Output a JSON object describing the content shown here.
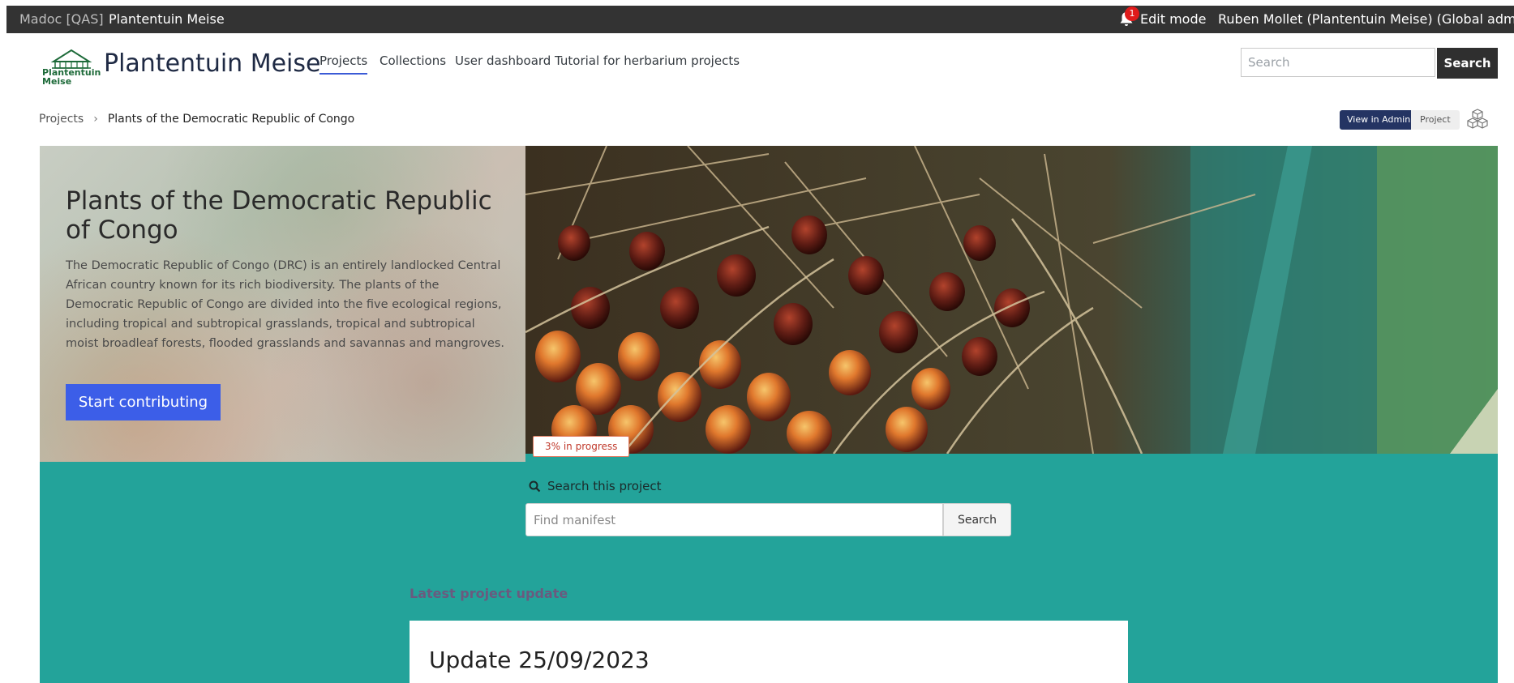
{
  "topbar": {
    "site_label": "Madoc [QAS]",
    "site_name": "Plantentuin Meise",
    "notification_count": "1",
    "edit_mode": "Edit mode",
    "user": "Ruben Mollet (Plantentuin Meise) (Global admin)"
  },
  "header": {
    "logo_line1": "Plantentuin",
    "logo_line2": "Meise",
    "title": "Plantentuin Meise",
    "nav": [
      "Projects",
      "Collections",
      "User dashboard",
      "Tutorial for herbarium projects"
    ],
    "search_placeholder": "Search",
    "search_button": "Search"
  },
  "breadcrumb": {
    "root": "Projects",
    "current": "Plants of the Democratic Republic of Congo"
  },
  "admin": {
    "view_in_admin": "View in Admin",
    "project": "Project"
  },
  "hero": {
    "title": "Plants of the Democratic Republic of Congo",
    "description": "The Democratic Republic of Congo (DRC) is an entirely landlocked Central African country known for its rich biodiversity. The plants of the Democratic Republic of Congo are divided into the five ecological regions, including tropical and subtropical grasslands, tropical and subtropical moist broadleaf forests, flooded grasslands and savannas and mangroves.",
    "cta": "Start contributing",
    "progress": "3% in progress"
  },
  "project_search": {
    "label": "Search this project",
    "placeholder": "Find manifest",
    "button": "Search"
  },
  "updates": {
    "heading": "Latest project update",
    "title": "Update 25/09/2023"
  },
  "colors": {
    "teal": "#23a39a",
    "accent_blue": "#3c5ee8",
    "admin_navy": "#243463",
    "topbar": "#333333"
  }
}
